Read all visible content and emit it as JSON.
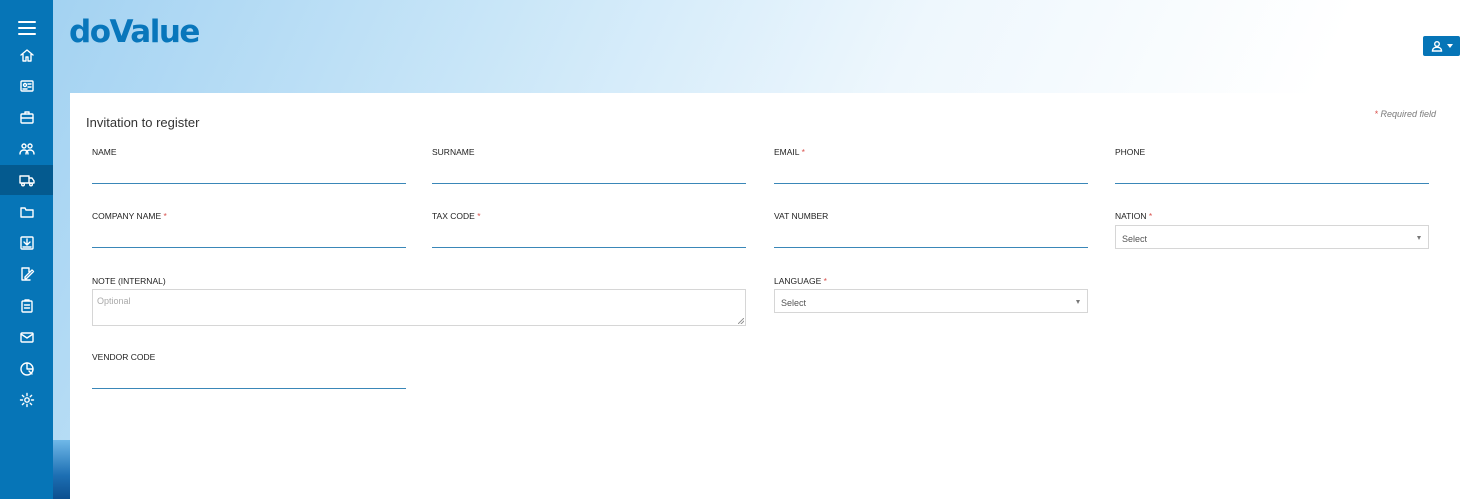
{
  "brand": {
    "logo_text": "doValue",
    "accent": "#0675b7"
  },
  "sidebar": {
    "items": [
      {
        "icon": "menu-icon"
      },
      {
        "icon": "home-icon"
      },
      {
        "icon": "id-card-icon"
      },
      {
        "icon": "briefcase-icon"
      },
      {
        "icon": "users-icon"
      },
      {
        "icon": "truck-icon",
        "active": true
      },
      {
        "icon": "folder-icon"
      },
      {
        "icon": "download-box-icon"
      },
      {
        "icon": "edit-document-icon"
      },
      {
        "icon": "clipboard-icon"
      },
      {
        "icon": "mail-icon"
      },
      {
        "icon": "pie-chart-icon"
      },
      {
        "icon": "gear-icon"
      }
    ]
  },
  "header": {
    "user_icon": "user-icon"
  },
  "form": {
    "title": "Invitation to register",
    "required_note": "Required field",
    "required_mark": "*",
    "fields": {
      "name": {
        "label": "NAME"
      },
      "surname": {
        "label": "SURNAME"
      },
      "email": {
        "label": "EMAIL"
      },
      "phone": {
        "label": "PHONE"
      },
      "company_name": {
        "label": "COMPANY NAME"
      },
      "tax_code": {
        "label": "TAX CODE"
      },
      "vat_number": {
        "label": "VAT NUMBER"
      },
      "nation": {
        "label": "NATION",
        "value": "Select"
      },
      "note": {
        "label": "NOTE (INTERNAL)",
        "placeholder": "Optional"
      },
      "language": {
        "label": "LANGUAGE",
        "value": "Select"
      },
      "vendor_code": {
        "label": "VENDOR CODE"
      }
    }
  }
}
